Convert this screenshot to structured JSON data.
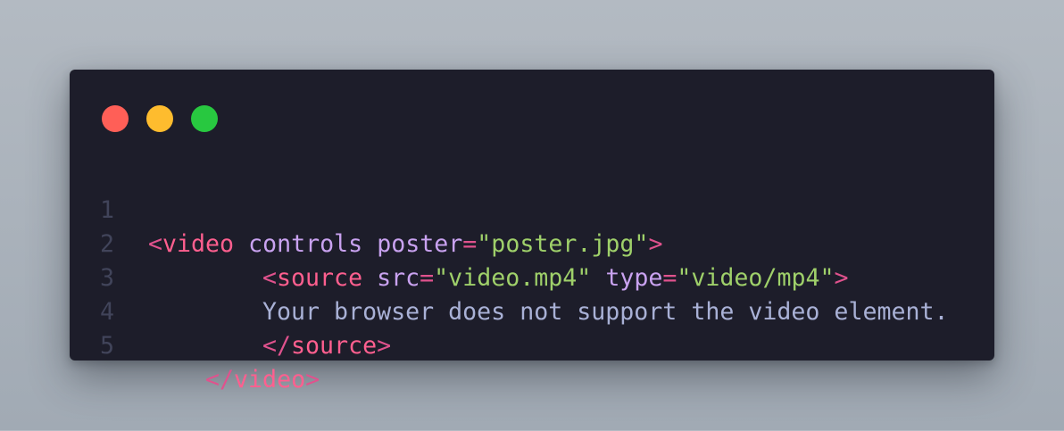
{
  "window": {
    "buttons": [
      "close",
      "minimize",
      "maximize"
    ],
    "colors": {
      "background": "#1d1d2a",
      "close": "#ff5f57",
      "minimize": "#febc2e",
      "maximize": "#28c840"
    }
  },
  "code": {
    "language": "html",
    "lines": [
      {
        "number": "1",
        "tokens": [
          {
            "text": "<",
            "type": "punct"
          },
          {
            "text": "video",
            "type": "tag"
          },
          {
            "text": " ",
            "type": "text"
          },
          {
            "text": "controls",
            "type": "attr"
          },
          {
            "text": " ",
            "type": "text"
          },
          {
            "text": "poster",
            "type": "attr"
          },
          {
            "text": "=",
            "type": "eq"
          },
          {
            "text": "\"poster.jpg\"",
            "type": "str"
          },
          {
            "text": ">",
            "type": "punct"
          }
        ]
      },
      {
        "number": "2",
        "tokens": [
          {
            "text": "<",
            "type": "punct"
          },
          {
            "text": "source",
            "type": "tag"
          },
          {
            "text": " ",
            "type": "text"
          },
          {
            "text": "src",
            "type": "attr"
          },
          {
            "text": "=",
            "type": "eq"
          },
          {
            "text": "\"video.mp4\"",
            "type": "str"
          },
          {
            "text": " ",
            "type": "text"
          },
          {
            "text": "type",
            "type": "attr"
          },
          {
            "text": "=",
            "type": "eq"
          },
          {
            "text": "\"video/mp4\"",
            "type": "str"
          },
          {
            "text": ">",
            "type": "punct"
          }
        ]
      },
      {
        "number": "3",
        "tokens": [
          {
            "text": "Your browser does not support the video element.",
            "type": "text"
          }
        ]
      },
      {
        "number": "4",
        "tokens": [
          {
            "text": "</",
            "type": "punct"
          },
          {
            "text": "source",
            "type": "tag"
          },
          {
            "text": ">",
            "type": "punct"
          }
        ]
      },
      {
        "number": "5",
        "tokens": [
          {
            "text": "</",
            "type": "punct"
          },
          {
            "text": "video",
            "type": "tag"
          },
          {
            "text": ">",
            "type": "punct"
          }
        ]
      }
    ]
  }
}
